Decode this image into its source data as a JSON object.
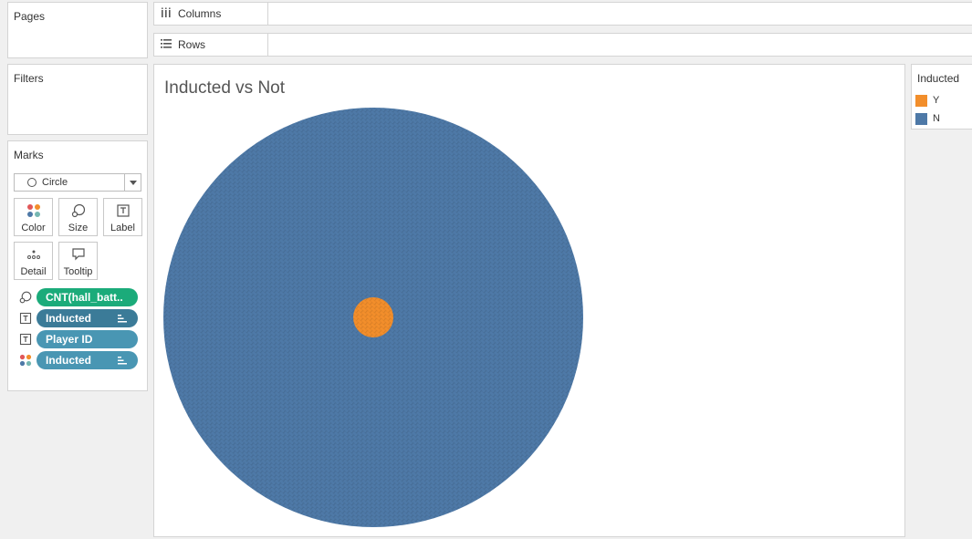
{
  "pages": {
    "title": "Pages"
  },
  "shelves": {
    "columns": {
      "label": "Columns",
      "icon": "columns-icon"
    },
    "rows": {
      "label": "Rows",
      "icon": "rows-icon"
    }
  },
  "filters": {
    "title": "Filters"
  },
  "marks": {
    "title": "Marks",
    "mark_type": "Circle",
    "buttons": [
      {
        "label": "Color",
        "icon": "color-icon"
      },
      {
        "label": "Size",
        "icon": "size-icon"
      },
      {
        "label": "Label",
        "icon": "label-icon"
      },
      {
        "label": "Detail",
        "icon": "detail-icon"
      },
      {
        "label": "Tooltip",
        "icon": "tooltip-icon"
      }
    ],
    "pills": [
      {
        "label": "CNT(hall_batt..",
        "icon": "size-icon",
        "color": "#1bab7a"
      },
      {
        "label": "Inducted",
        "icon": "label-text-icon",
        "color": "#3b7b98",
        "sorted": true
      },
      {
        "label": "Player ID",
        "icon": "label-text-icon",
        "color": "#4996b3"
      },
      {
        "label": "Inducted",
        "icon": "color-icon",
        "color": "#4996b3",
        "sorted": true
      }
    ]
  },
  "legend": {
    "title": "Inducted",
    "items": [
      {
        "label": "Y",
        "color": "#f28e2b"
      },
      {
        "label": "N",
        "color": "#4e79a7"
      }
    ]
  },
  "viz": {
    "title": "Inducted vs Not"
  },
  "chart_data": {
    "type": "packed-bubble",
    "title": "Inducted vs Not",
    "series": [
      {
        "name": "N",
        "color": "#4e79a7"
      },
      {
        "name": "Y",
        "color": "#f28e2b"
      }
    ]
  }
}
